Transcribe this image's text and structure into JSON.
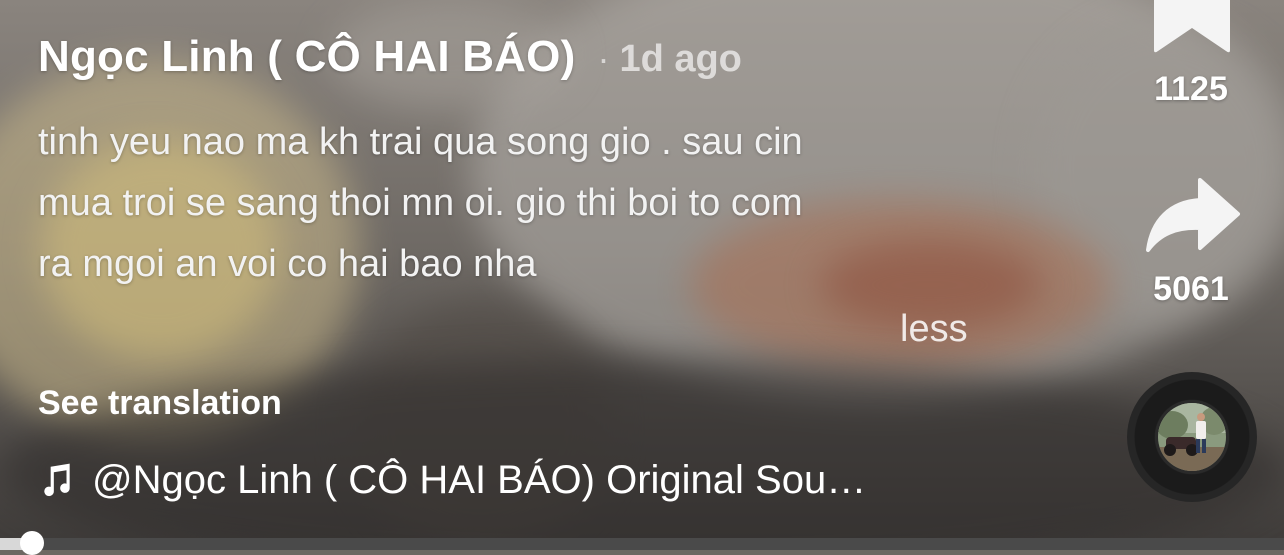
{
  "post": {
    "author": "Ngọc Linh ( CÔ HAI BÁO)",
    "separator": "·",
    "time_ago": "1d ago",
    "caption_lines": [
      "tinh yeu nao ma kh trai qua song gio  . sau cin",
      "mua troi se sang thoi mn oi. gio thi boi to com",
      "ra mgoi an voi co hai bao nha"
    ],
    "less_label": "less",
    "see_translation_label": "See translation",
    "sound_label": "@Ngọc Linh ( CÔ HAI BÁO) Original Sou…"
  },
  "actions": {
    "bookmark": {
      "icon": "bookmark-icon",
      "count": "1125"
    },
    "share": {
      "icon": "share-arrow-icon",
      "count": "5061"
    },
    "sound_disc": {
      "icon": "music-disc-avatar"
    }
  },
  "icons": {
    "sound": "music-note-icon"
  },
  "progress": {
    "fraction": 0.025
  },
  "colors": {
    "text": "#ffffff",
    "muted_text": "#b8b4af",
    "progress_track": "#4a4a4a",
    "progress_fill": "#d8d8d8"
  }
}
